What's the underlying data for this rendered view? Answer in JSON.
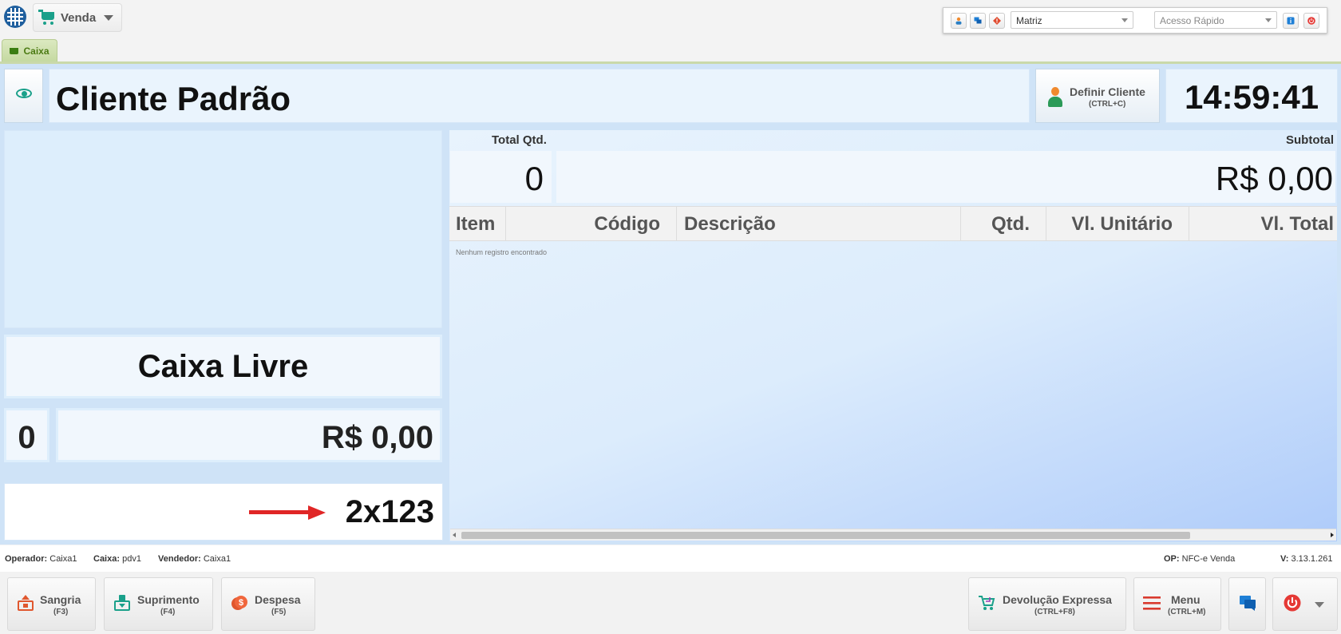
{
  "topbar": {
    "app_menu_label": "Venda",
    "store_select": "Matriz",
    "quick_access_placeholder": "Acesso Rápido"
  },
  "tabs": [
    {
      "label": "Caixa"
    }
  ],
  "header": {
    "client_name": "Cliente Padrão",
    "define_client_label": "Definir Cliente",
    "define_client_shortcut": "(CTRL+C)",
    "clock": "14:59:41"
  },
  "left": {
    "status": "Caixa Livre",
    "qty": "0",
    "total": "R$ 0,00",
    "input_value": "2x123"
  },
  "right": {
    "total_qty_label": "Total Qtd.",
    "total_qty": "0",
    "subtotal_label": "Subtotal",
    "subtotal": "R$ 0,00",
    "columns": [
      "Item",
      "Código",
      "Descrição",
      "Qtd.",
      "Vl. Unitário",
      "Vl. Total"
    ],
    "empty_message": "Nenhum registro encontrado"
  },
  "statusbar": {
    "operador_label": "Operador:",
    "operador": "Caixa1",
    "caixa_label": "Caixa:",
    "caixa": "pdv1",
    "vendedor_label": "Vendedor:",
    "vendedor": "Caixa1",
    "op_label": "OP:",
    "op": "NFC-e Venda",
    "version_label": "V:",
    "version": "3.13.1.261"
  },
  "actions": {
    "sangria": {
      "label": "Sangria",
      "shortcut": "(F3)"
    },
    "suprimento": {
      "label": "Suprimento",
      "shortcut": "(F4)"
    },
    "despesa": {
      "label": "Despesa",
      "shortcut": "(F5)"
    },
    "devolucao": {
      "label": "Devolução Expressa",
      "shortcut": "(CTRL+F8)"
    },
    "menu": {
      "label": "Menu",
      "shortcut": "(CTRL+M)"
    }
  },
  "colors": {
    "accent_teal": "#1aa08a",
    "danger_red": "#e02626",
    "panel_blue": "#cfe3f7"
  }
}
